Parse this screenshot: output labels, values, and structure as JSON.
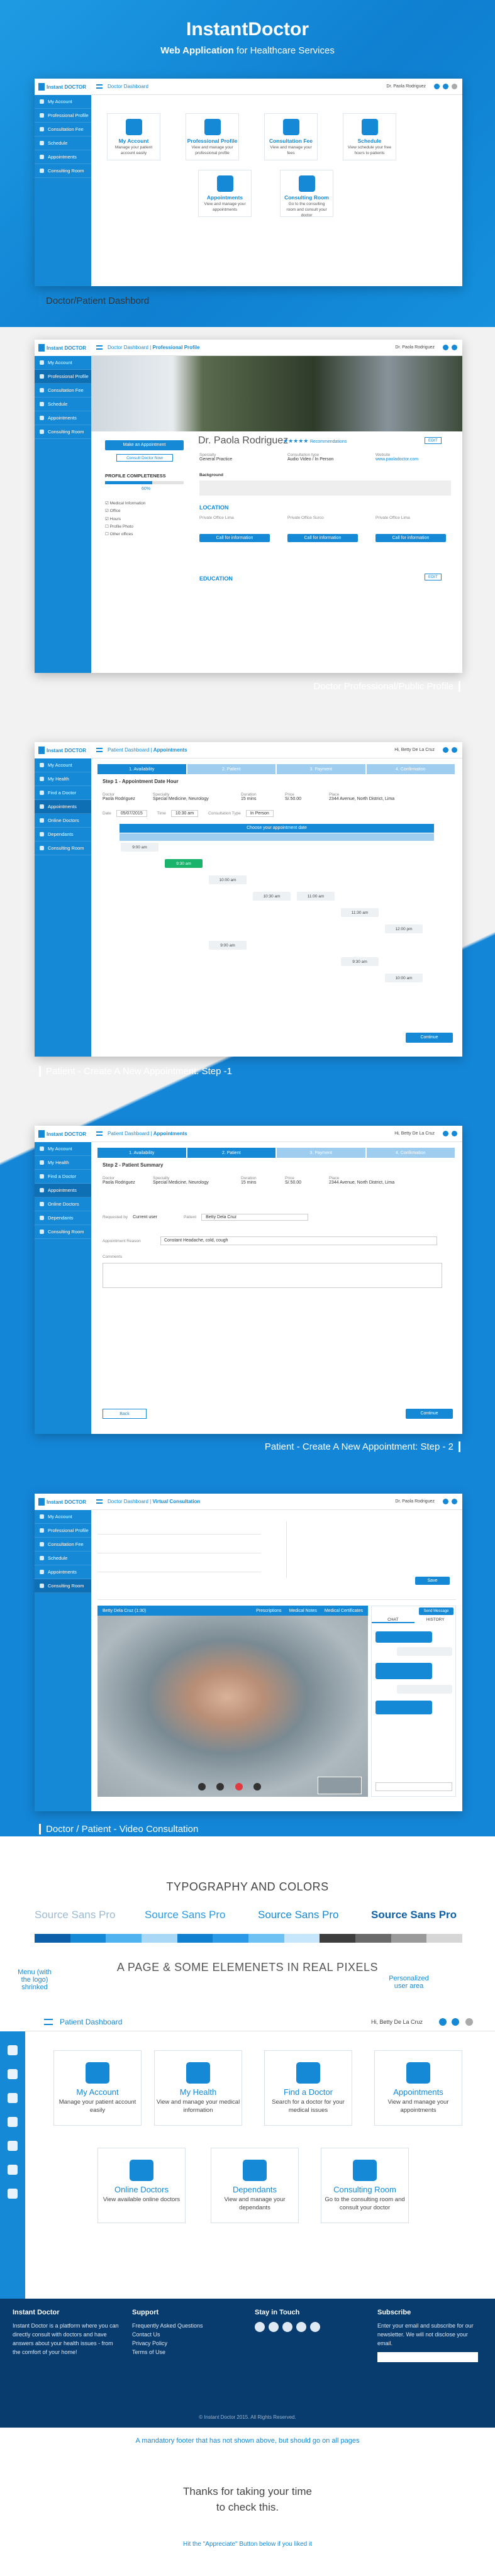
{
  "header": {
    "title": "InstantDoctor",
    "subtitle_strong": "Web Application",
    "subtitle_rest": " for Healthcare Services"
  },
  "common": {
    "logo": "Instant DOCTOR",
    "user_doctor": "Dr. Paola Rodriguez",
    "user_patient": "Hi, Betty De La Cruz",
    "sidebar_doctor": [
      "My Account",
      "Professional Profile",
      "Consultation Fee",
      "Schedule",
      "Appointments",
      "Consulting Room"
    ],
    "sidebar_patient": [
      "My Account",
      "My Health",
      "Find a Doctor",
      "Appointments",
      "Online Doctors",
      "Dependants",
      "Consulting Room"
    ]
  },
  "screen1": {
    "breadcrumb": "Doctor Dashboard",
    "caption": "Doctor/Patient Dashbord",
    "cards": [
      {
        "title": "My Account",
        "desc": "Manage your patient account easily"
      },
      {
        "title": "Professional Profile",
        "desc": "View and manage your professional profile"
      },
      {
        "title": "Consultation Fee",
        "desc": "View and manage your fees"
      },
      {
        "title": "Schedule",
        "desc": "View schedule your free hours to patients"
      },
      {
        "title": "Appointments",
        "desc": "View and manage your appointments"
      },
      {
        "title": "Consulting Room",
        "desc": "Go to the consulting room and consult your doctor"
      }
    ]
  },
  "screen2": {
    "breadcrumb": "Doctor Dashboard",
    "breadcrumb_strong": "Professional Profile",
    "caption": "Doctor Professional/Public Profile",
    "name": "Dr. Paola Rodriguez",
    "rating_label": "Recommendations",
    "make_appt": "Make an Appointment",
    "consult_now": "Consult Doctor Now",
    "completeness_label": "PROFILE COMPLETENESS",
    "completeness_value": "60%",
    "completeness_fraction": 0.6,
    "specialty_label": "Specialty",
    "specialty": "General Practice",
    "lang_label": "Consultation type",
    "lang": "Audio Video / In Person",
    "website_label": "Website",
    "website": "www.paoladoctor.com",
    "background_label": "Background",
    "location_title": "LOCATION",
    "education_title": "EDUCATION",
    "office_titles": [
      "Private Office Lima",
      "Private Office Surco",
      "Private Office Lima"
    ],
    "call_label": "Call for information",
    "list_items": [
      "Medical Information",
      "Office",
      "Hours",
      "Profile Photo",
      "Other offices"
    ],
    "edit": "EDIT"
  },
  "screen3": {
    "breadcrumb": "Patient Dashboard",
    "breadcrumb_strong": "Appointments",
    "caption": "Patient - Create A New Appointment: Step -1",
    "steps": [
      "1. Availability",
      "2. Patient",
      "3. Payment",
      "4. Confirmation"
    ],
    "step_title": "Step 1 - Appointment Date Hour",
    "doctor_label": "Doctor",
    "doctor": "Paola Rodriguez",
    "specialty_label": "Specialty",
    "specialty": "Special Medicine, Neurology",
    "duration_label": "Duration",
    "duration": "15 mins",
    "price_label": "Price",
    "price": "S/.50.00",
    "place_label": "Place",
    "place": "2344 Avenue, North District, Lima",
    "date_label": "Date",
    "date": "05/07/2015",
    "time_label": "Time",
    "time": "10:30 am",
    "type_label": "Consultation Type",
    "type": "In Person",
    "grid_title": "Choose your appointment date",
    "slots": [
      "9:00 am",
      "9:30 am",
      "10:00 am",
      "10:30 am",
      "11:00 am",
      "11:30 am",
      "12:00 pm"
    ],
    "continue": "Continue"
  },
  "screen4": {
    "breadcrumb": "Patient Dashboard",
    "breadcrumb_strong": "Appointments",
    "caption": "Patient -  Create A New Appointment: Step - 2",
    "steps": [
      "1. Availability",
      "2. Patient",
      "3. Payment",
      "4. Confirmation"
    ],
    "step_title": "Step 2 - Patient Summary",
    "requested_label": "Requested by",
    "requested": "Current user",
    "patient_label": "Patient",
    "patient": "Betty Dela Cruz",
    "reason_label": "Appointment Reason",
    "reason": "Constant Headache, cold, cough",
    "comments_label": "Comments",
    "back": "Back",
    "continue": "Continue"
  },
  "screen5": {
    "breadcrumb": "Doctor Dashboard",
    "breadcrumb_strong": "Virtual Consultation",
    "caption": "Doctor / Patient - Video Consultation",
    "patient_name": "Betty Dela Cruz (1:30)",
    "tabs": [
      "Prescriptions",
      "Medical Notes",
      "Medical Certificates"
    ],
    "send": "Send Message",
    "chat_tabs": [
      "CHAT",
      "HISTORY"
    ],
    "save": "Save"
  },
  "typography": {
    "title": "TYPOGRAPHY AND COLORS",
    "samples": [
      "Source Sans Pro",
      "Source Sans Pro",
      "Source Sans Pro",
      "Source Sans Pro"
    ],
    "colors": [
      "#0c5fa8",
      "#1589d6",
      "#4fb3ef",
      "#a9d8f7",
      "#0f7fd0",
      "#2a9ae6",
      "#6ec1f3",
      "#c6e6fb",
      "#3d3d3d",
      "#6a6a6a",
      "#9a9a9a",
      "#d6d6d6"
    ]
  },
  "demo": {
    "title": "A PAGE & SOME ELEMENETS IN REAL PIXELS",
    "note_left": "Menu (with the logo) shrinked",
    "note_right": "Personalized user area",
    "breadcrumb": "Patient Dashboard",
    "user": "Hi, Betty De La Cruz",
    "cards": [
      {
        "title": "My Account",
        "desc": "Manage your patient account easily"
      },
      {
        "title": "My Health",
        "desc": "View and manage your medical information"
      },
      {
        "title": "Find a Doctor",
        "desc": "Search for a doctor for your medical issues"
      },
      {
        "title": "Appointments",
        "desc": "View and manage your appointments"
      },
      {
        "title": "Online Doctors",
        "desc": "View available online doctors"
      },
      {
        "title": "Dependants",
        "desc": "View and manage your dependants"
      },
      {
        "title": "Consulting Room",
        "desc": "Go to the consulting room and consult your doctor"
      }
    ]
  },
  "footer": {
    "about_title": "Instant Doctor",
    "about_text": "Instant Doctor is a platform where you can directly consult with doctors and have answers about your health issues - from the comfort of your home!",
    "support_title": "Support",
    "support_links": [
      "Frequently Asked Questions",
      "Contact Us",
      "Privacy Policy",
      "Terms of Use"
    ],
    "social_title": "Stay in Touch",
    "subscribe_title": "Subscribe",
    "subscribe_text": "Enter your email and subscribe for our newsletter. We will not disclose your email.",
    "copyright": "© Instant Doctor 2015. All Rights Reserved."
  },
  "footer_note": "A mandatory footer that has not shown above, but should go on all pages",
  "thanks": {
    "line1": "Thanks for taking your time",
    "line2": "to check this.",
    "appreciate": "Hit the \"Appreciate\" Button below if you liked it"
  }
}
